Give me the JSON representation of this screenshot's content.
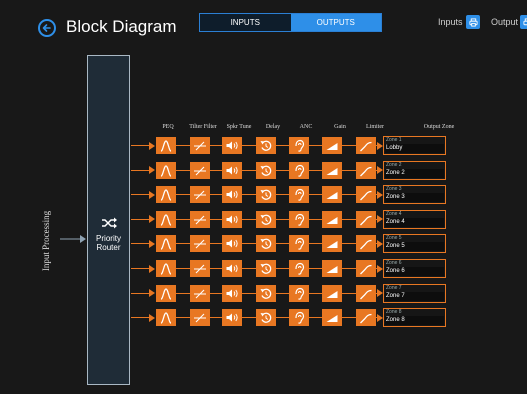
{
  "header": {
    "title": "Block Diagram",
    "tabs": [
      "INPUTS",
      "OUTPUTS"
    ],
    "inputs_label": "Inputs",
    "outputs_label": "Output"
  },
  "input_processing_label": "Input Processing",
  "router_label": "Priority Router",
  "columns": [
    "PEQ",
    "Tilter Filter",
    "Spkr Tune",
    "Delay",
    "ANC",
    "Gain",
    "Limiter",
    "Output Zone"
  ],
  "zones": [
    {
      "name": "Zone 1",
      "value": "Lobby"
    },
    {
      "name": "Zone 2",
      "value": "Zone 2"
    },
    {
      "name": "Zone 3",
      "value": "Zone 3"
    },
    {
      "name": "Zone 4",
      "value": "Zone 4"
    },
    {
      "name": "Zone 5",
      "value": "Zone 5"
    },
    {
      "name": "Zone 6",
      "value": "Zone 6"
    },
    {
      "name": "Zone 7",
      "value": "Zone 7"
    },
    {
      "name": "Zone 8",
      "value": "Zone 8"
    }
  ],
  "icons": [
    "peq-curve-icon",
    "tilt-filter-icon",
    "speaker-icon",
    "delay-icon",
    "ear-icon",
    "gain-ramp-icon",
    "limiter-curve-icon"
  ],
  "colors": {
    "accent": "#e87722",
    "primary": "#2e8fe8",
    "background": "#181818"
  }
}
